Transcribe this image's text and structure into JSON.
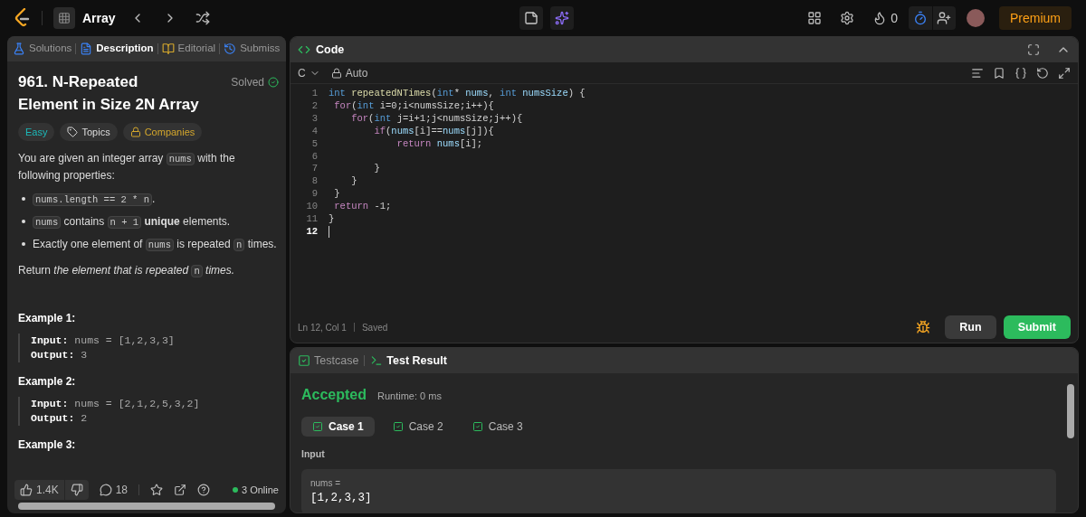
{
  "top_bar": {
    "problem_list": "Array",
    "coins": "0",
    "premium": "Premium"
  },
  "left_tabs": [
    {
      "label": "Solutions",
      "kind": "flask",
      "selected": false
    },
    {
      "label": "Description",
      "kind": "doc",
      "selected": true
    },
    {
      "label": "Editorial",
      "kind": "book",
      "selected": false
    },
    {
      "label": "Submiss",
      "kind": "history",
      "selected": false
    }
  ],
  "problem": {
    "title": "961. N-Repeated Element in Size 2N Array",
    "status": "Solved",
    "difficulty": "Easy",
    "tags": [
      {
        "label": "Topics",
        "kind": "tag"
      },
      {
        "label": "Companies",
        "kind": "lock"
      }
    ],
    "intro": [
      {
        "text": "You are given an integer array ",
        "kind": "text"
      },
      {
        "text": "nums",
        "kind": "code"
      },
      {
        "text": " with the following properties:",
        "kind": "text"
      }
    ],
    "bullets": [
      [
        {
          "text": "nums.length == 2 * n",
          "kind": "code"
        },
        {
          "text": ".",
          "kind": "text"
        }
      ],
      [
        {
          "text": "nums",
          "kind": "code"
        },
        {
          "text": " contains ",
          "kind": "text"
        },
        {
          "text": "n + 1",
          "kind": "code"
        },
        {
          "text": " unique",
          "kind": "bold"
        },
        {
          "text": " elements.",
          "kind": "text"
        }
      ],
      [
        {
          "text": "Exactly one element of ",
          "kind": "text"
        },
        {
          "text": "nums",
          "kind": "code"
        },
        {
          "text": " is repeated ",
          "kind": "text"
        },
        {
          "text": "n",
          "kind": "code"
        },
        {
          "text": " times.",
          "kind": "text"
        }
      ]
    ],
    "returns": [
      {
        "text": "Return ",
        "kind": "text"
      },
      {
        "text": "the element that is repeated ",
        "kind": "italic"
      },
      {
        "text": "n",
        "kind": "code"
      },
      {
        "text": " times.",
        "kind": "italic"
      }
    ],
    "examples": [
      {
        "title": "Example 1:",
        "input_label": "Input:",
        "input": "nums = [1,2,3,3]",
        "output_label": "Output:",
        "output": "3"
      },
      {
        "title": "Example 2:",
        "input_label": "Input:",
        "input": "nums = [2,1,2,5,3,2]",
        "output_label": "Output:",
        "output": "2"
      },
      {
        "title": "Example 3:"
      }
    ]
  },
  "left_footer": {
    "likes": "1.4K",
    "comments": "18",
    "online": "3 Online"
  },
  "code_panel": {
    "title": "Code",
    "language": "C",
    "mode": "Auto",
    "lines": [
      {
        "number": "1",
        "current": false,
        "tokens": [
          {
            "text": "int",
            "kind": "type"
          },
          {
            "text": " repeatedNTimes",
            "kind": "func"
          },
          {
            "text": "(",
            "kind": "plain"
          },
          {
            "text": "int",
            "kind": "type"
          },
          {
            "text": "* ",
            "kind": "plain"
          },
          {
            "text": "nums",
            "kind": "var"
          },
          {
            "text": ", ",
            "kind": "plain"
          },
          {
            "text": "int",
            "kind": "type"
          },
          {
            "text": " numsSize",
            "kind": "var"
          },
          {
            "text": ") {",
            "kind": "plain"
          }
        ]
      },
      {
        "number": "2",
        "current": false,
        "tokens": [
          {
            "text": " for",
            "kind": "control"
          },
          {
            "text": "(",
            "kind": "plain"
          },
          {
            "text": "int",
            "kind": "type"
          },
          {
            "text": " i=0;i<numsSize;i++){",
            "kind": "plain"
          }
        ]
      },
      {
        "number": "3",
        "current": false,
        "tokens": [
          {
            "text": "    for",
            "kind": "control"
          },
          {
            "text": "(",
            "kind": "plain"
          },
          {
            "text": "int",
            "kind": "type"
          },
          {
            "text": " j=i+1;j<numsSize;j++){",
            "kind": "plain"
          }
        ]
      },
      {
        "number": "4",
        "current": false,
        "tokens": [
          {
            "text": "        if",
            "kind": "control"
          },
          {
            "text": "(",
            "kind": "plain"
          },
          {
            "text": "nums",
            "kind": "var"
          },
          {
            "text": "[i]==",
            "kind": "plain"
          },
          {
            "text": "nums",
            "kind": "var"
          },
          {
            "text": "[j]){",
            "kind": "plain"
          }
        ]
      },
      {
        "number": "5",
        "current": false,
        "tokens": [
          {
            "text": "            return",
            "kind": "control"
          },
          {
            "text": " nums",
            "kind": "var"
          },
          {
            "text": "[i];",
            "kind": "plain"
          }
        ]
      },
      {
        "number": "6",
        "current": false
      },
      {
        "number": "7",
        "current": false,
        "tokens": [
          {
            "text": "        }",
            "kind": "plain"
          }
        ]
      },
      {
        "number": "8",
        "current": false,
        "tokens": [
          {
            "text": "    }",
            "kind": "plain"
          }
        ]
      },
      {
        "number": "9",
        "current": false,
        "tokens": [
          {
            "text": " }",
            "kind": "plain"
          }
        ]
      },
      {
        "number": "10",
        "current": false,
        "tokens": [
          {
            "text": " return",
            "kind": "control"
          },
          {
            "text": " -1;",
            "kind": "plain"
          }
        ]
      },
      {
        "number": "11",
        "current": false,
        "tokens": [
          {
            "text": "}",
            "kind": "plain"
          }
        ]
      },
      {
        "number": "12",
        "current": true
      }
    ],
    "cursor": "Ln 12, Col 1",
    "save_state": "Saved",
    "run": "Run",
    "submit": "Submit"
  },
  "test_panel": {
    "tabs": [
      {
        "label": "Testcase",
        "kind": "check",
        "selected": false
      },
      {
        "label": "Test Result",
        "kind": "terminal",
        "selected": true
      }
    ],
    "verdict": "Accepted",
    "runtime": "Runtime: 0 ms",
    "cases": [
      {
        "label": "Case 1",
        "selected": true
      },
      {
        "label": "Case 2",
        "selected": false
      },
      {
        "label": "Case 3",
        "selected": false
      }
    ],
    "input_label": "Input",
    "input_name": "nums =",
    "input_value": "[1,2,3,3]"
  }
}
